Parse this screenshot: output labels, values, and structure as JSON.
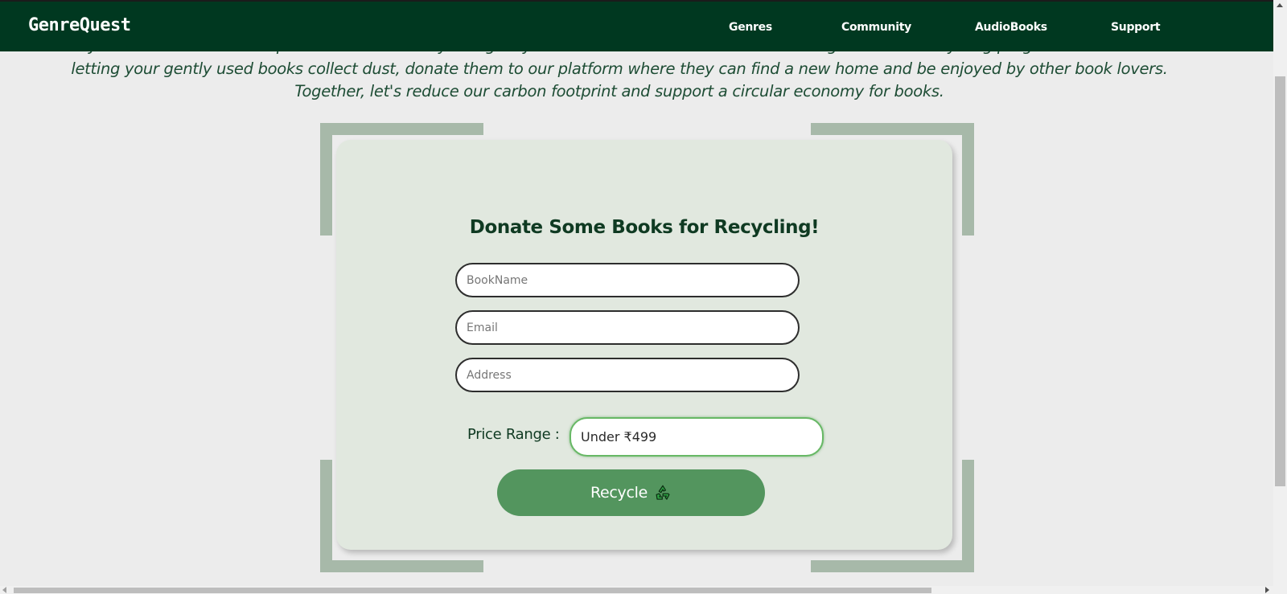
{
  "navbar": {
    "brand": "GenreQuest",
    "links": [
      "Genres",
      "Community",
      "AudioBooks",
      "Support"
    ]
  },
  "intro": {
    "text": "Join us in our mission to promote sustainability and give your old books a new lease on life through our book recycling program. Instead of letting your gently used books collect dust, donate them to our platform where they can find a new home and be enjoyed by other book lovers. Together, let's reduce our carbon footprint and support a circular economy for books."
  },
  "form": {
    "title": "Donate Some Books for Recycling!",
    "book_placeholder": "BookName",
    "email_placeholder": "Email",
    "address_placeholder": "Address",
    "price_label": "Price Range :",
    "price_value": "Under ₹499",
    "submit_label": "Recycle",
    "submit_icon": "recycle-icon"
  },
  "colors": {
    "navbar_bg": "#003820",
    "card_bg": "#e1e8df",
    "accent": "#53955e",
    "bracket": "#a7b9a9",
    "heading": "#0f3a22"
  }
}
